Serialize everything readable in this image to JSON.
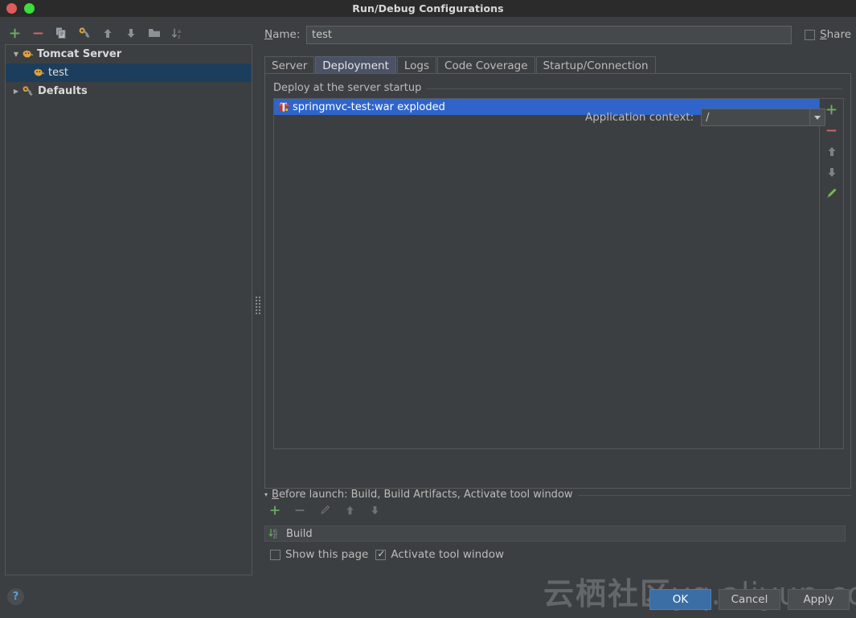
{
  "window": {
    "title": "Run/Debug Configurations",
    "controls": {
      "close": "close-window",
      "maximize": "maximize-window"
    }
  },
  "sidebar": {
    "toolbar": [
      {
        "name": "add-configuration",
        "glyph": "+",
        "color": "#6aaa64"
      },
      {
        "name": "remove-configuration",
        "glyph": "−",
        "color": "#cc6666"
      },
      {
        "name": "copy-configuration",
        "glyph": "copy",
        "color": "#9aa0a6"
      },
      {
        "name": "edit-templates",
        "glyph": "wrench",
        "color": "#d3a03c"
      },
      {
        "name": "move-up",
        "glyph": "↑",
        "color": "#8c9093"
      },
      {
        "name": "move-down",
        "glyph": "↓",
        "color": "#8c9093"
      },
      {
        "name": "move-into-folder",
        "glyph": "folder",
        "color": "#8c9093"
      },
      {
        "name": "sort-configurations",
        "glyph": "sort-az",
        "color": "#8c9093"
      }
    ],
    "tree": [
      {
        "label": "Tomcat Server",
        "level": 0,
        "expanded": true,
        "icon": "tomcat-icon",
        "selected": false,
        "bold": true,
        "arrow": "▼"
      },
      {
        "label": "test",
        "level": 1,
        "expanded": false,
        "icon": "tomcat-icon",
        "selected": true,
        "bold": false,
        "arrow": ""
      },
      {
        "label": "Defaults",
        "level": 0,
        "expanded": false,
        "icon": "wrench-icon",
        "selected": false,
        "bold": true,
        "arrow": "▶"
      }
    ]
  },
  "form": {
    "name_label": "Name:",
    "name_label_mnemonic": "N",
    "name_label_rest": "ame:",
    "name_value": "test",
    "share_label": "Share",
    "share_label_mnemonic": "S",
    "share_label_rest": "hare",
    "share_checked": false
  },
  "tabs": [
    {
      "label": "Server",
      "active": false
    },
    {
      "label": "Deployment",
      "active": true
    },
    {
      "label": "Logs",
      "active": false
    },
    {
      "label": "Code Coverage",
      "active": false
    },
    {
      "label": "Startup/Connection",
      "active": false
    }
  ],
  "deployment": {
    "group_title": "Deploy at the server startup",
    "artifacts": [
      {
        "label": "springmvc-test:war exploded",
        "icon": "artifact-icon",
        "selected": true
      }
    ],
    "side_buttons": [
      {
        "name": "add-artifact",
        "glyph": "+",
        "color": "#6aaa64"
      },
      {
        "name": "remove-artifact",
        "glyph": "−",
        "color": "#cc6666"
      },
      {
        "name": "move-artifact-up",
        "glyph": "↑",
        "color": "#8c9093"
      },
      {
        "name": "move-artifact-down",
        "glyph": "↓",
        "color": "#8c9093"
      },
      {
        "name": "edit-artifact",
        "glyph": "pencil",
        "color": "#7fbf5f"
      }
    ],
    "application_context_label": "Application context:",
    "application_context_value": "/"
  },
  "before_launch": {
    "title_prefix": "B",
    "title_rest": "efore launch: Build, Build Artifacts, Activate tool window",
    "title_full": "Before launch: Build, Build Artifacts, Activate tool window",
    "collapse_arrow": "▾",
    "toolbar": [
      {
        "name": "add-before-launch-task",
        "glyph": "+",
        "color": "#6aaa64",
        "enabled": true
      },
      {
        "name": "remove-before-launch-task",
        "glyph": "−",
        "color": "#6f7274",
        "enabled": false
      },
      {
        "name": "edit-before-launch-task",
        "glyph": "pencil",
        "color": "#6f7274",
        "enabled": false
      },
      {
        "name": "move-task-up",
        "glyph": "↑",
        "color": "#6f7274",
        "enabled": false
      },
      {
        "name": "move-task-down",
        "glyph": "↓",
        "color": "#6f7274",
        "enabled": false
      }
    ],
    "tasks": [
      {
        "label": "Build",
        "icon": "build-icon"
      }
    ],
    "show_this_page_label": "Show this page",
    "show_this_page_checked": false,
    "activate_tool_window_label": "Activate tool window",
    "activate_tool_window_checked": true
  },
  "footer": {
    "help_glyph": "?",
    "buttons": [
      {
        "label": "OK",
        "default": true
      },
      {
        "label": "Cancel",
        "default": false
      },
      {
        "label": "Apply",
        "default": false
      }
    ]
  },
  "watermark": {
    "cn": "云栖社区",
    "url": "yq.aliyun.com"
  },
  "colors": {
    "window_bg": "#3c3f41",
    "titlebar_bg": "#2b2b2b",
    "selection_blue": "#2f65ca",
    "tree_selection": "#1c3d5c",
    "accent_green": "#6aaa64",
    "default_button": "#3b6ea5"
  }
}
